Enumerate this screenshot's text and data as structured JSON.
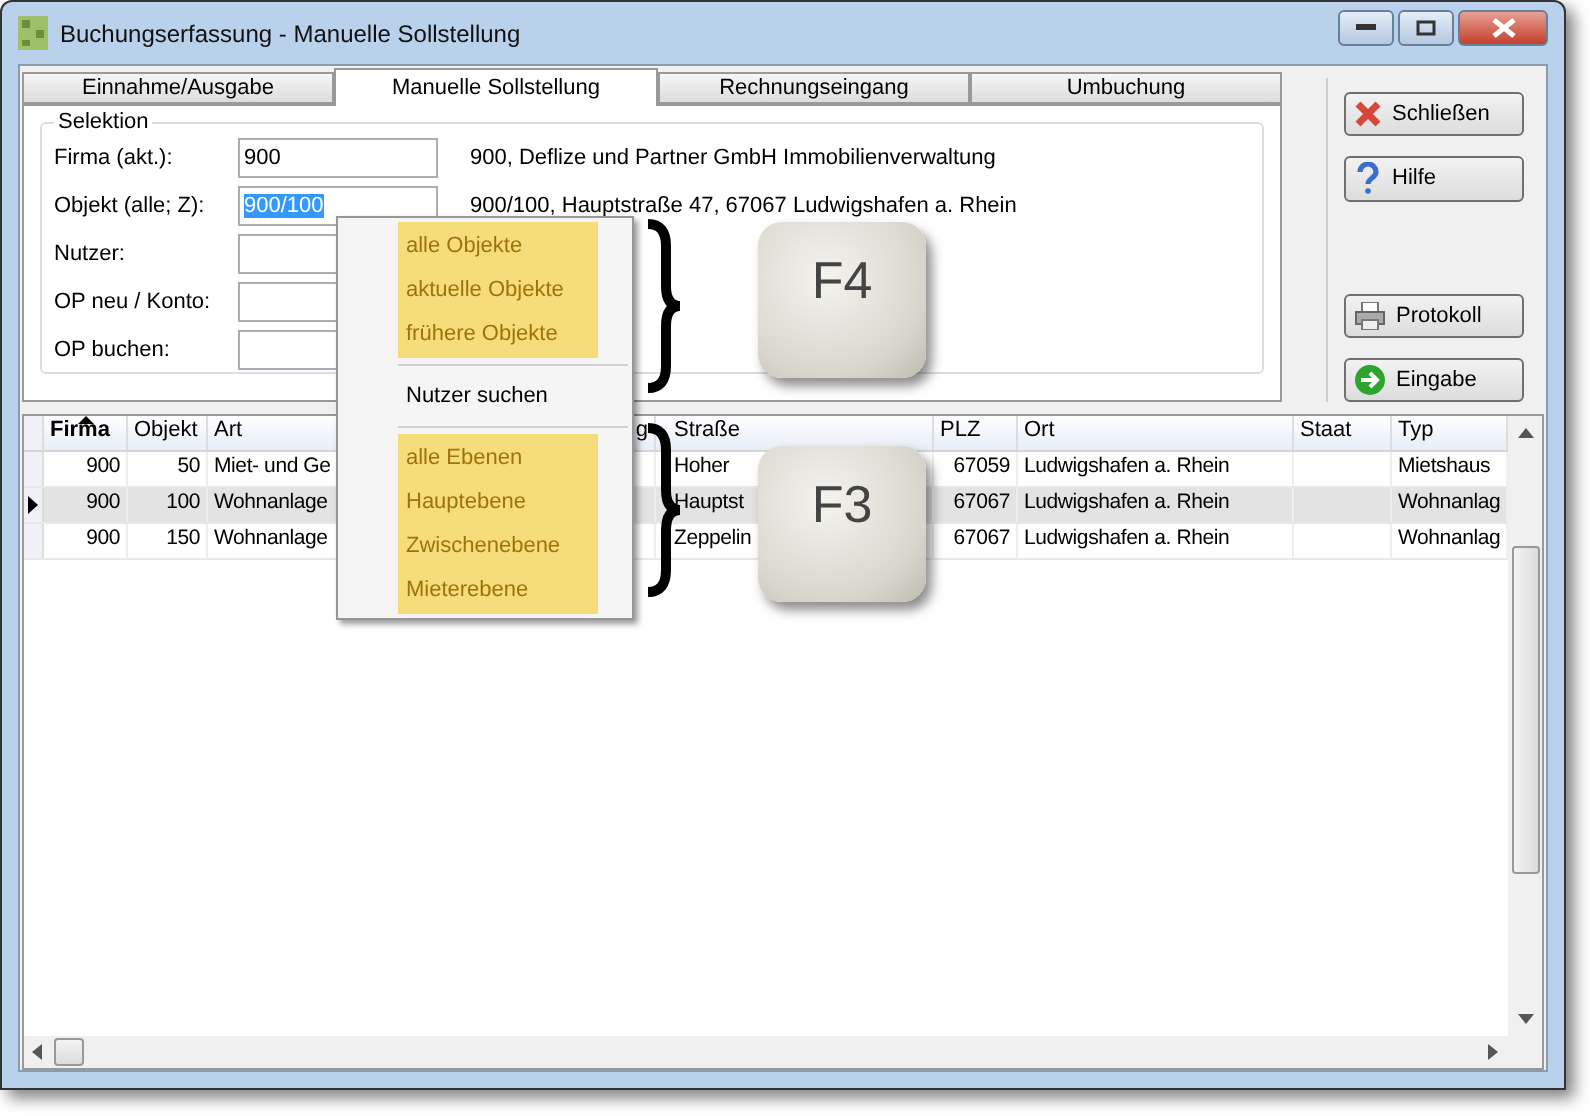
{
  "window": {
    "title": "Buchungserfassung - Manuelle Sollstellung"
  },
  "tabs": [
    {
      "label": "Einnahme/Ausgabe",
      "selected": false
    },
    {
      "label": "Manuelle Sollstellung",
      "selected": true
    },
    {
      "label": "Rechnungseingang",
      "selected": false
    },
    {
      "label": "Umbuchung",
      "selected": false
    }
  ],
  "selection": {
    "title": "Selektion",
    "fields": [
      {
        "label": "Firma (akt.):",
        "value": "900",
        "text_selected": false,
        "info": "900,  Deflize und Partner GmbH Immobilienverwaltung"
      },
      {
        "label": "Objekt (alle; Z):",
        "value": "900/100",
        "text_selected": true,
        "info": "900/100,  Hauptstraße 47, 67067 Ludwigshafen a. Rhein"
      },
      {
        "label": "Nutzer:"
      },
      {
        "label": "OP neu / Konto:"
      },
      {
        "label": "OP buchen:"
      }
    ]
  },
  "buttons": [
    {
      "label": "Schließen",
      "kind": "close"
    },
    {
      "label": "Hilfe",
      "kind": "help"
    },
    {
      "label": "Protokoll",
      "kind": "print"
    },
    {
      "label": "Eingabe",
      "kind": "enter"
    }
  ],
  "table": {
    "columns": [
      {
        "label": "Firma",
        "sorted": true
      },
      {
        "label": "Objekt",
        "sorted": false
      },
      {
        "label": "Art",
        "sorted": false
      },
      {
        "label": "g",
        "sorted": false
      },
      {
        "label": "Straße",
        "sorted": false
      },
      {
        "label": "PLZ",
        "sorted": false
      },
      {
        "label": "Ort",
        "sorted": false
      },
      {
        "label": "Staat",
        "sorted": false
      },
      {
        "label": "Typ",
        "sorted": false
      }
    ],
    "rows": [
      {
        "selected": false,
        "cells": [
          "900",
          "50",
          "Miet- und Ge",
          "",
          "Hoher",
          "67059",
          "Ludwigshafen a. Rhein",
          "",
          "Mietshaus"
        ]
      },
      {
        "selected": true,
        "cells": [
          "900",
          "100",
          "Wohnanlage",
          "",
          "Hauptst",
          "67067",
          "Ludwigshafen a. Rhein",
          "",
          "Wohnanlag"
        ]
      },
      {
        "selected": false,
        "cells": [
          "900",
          "150",
          "Wohnanlage",
          "",
          "Zeppelin",
          "67067",
          "Ludwigshafen a. Rhein",
          "",
          "Wohnanlag"
        ]
      }
    ]
  },
  "context_menu": {
    "groups": [
      {
        "highlighted": true,
        "items": [
          "alle Objekte",
          "aktuelle Objekte",
          "frühere Objekte"
        ]
      },
      {
        "highlighted": false,
        "items": [
          "Nutzer suchen"
        ]
      },
      {
        "highlighted": true,
        "items": [
          "alle Ebenen",
          "Hauptebene",
          "Zwischenebene",
          "Mieterebene"
        ]
      }
    ]
  },
  "keycaps": [
    {
      "label": "F4"
    },
    {
      "label": "F3"
    }
  ]
}
